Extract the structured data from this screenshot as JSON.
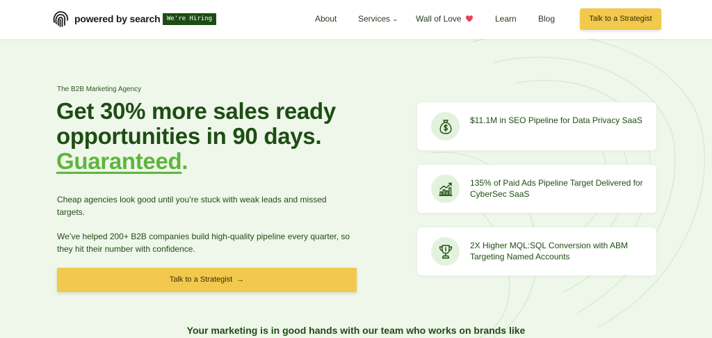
{
  "header": {
    "logo_text": "powered by search",
    "hiring_badge": "We're Hiring",
    "nav": [
      {
        "label": "About"
      },
      {
        "label": "Services"
      },
      {
        "label": "Wall of Love"
      },
      {
        "label": "Learn"
      },
      {
        "label": "Blog"
      }
    ],
    "cta_label": "Talk to a Strategist"
  },
  "hero": {
    "eyebrow": "The B2B Marketing Agency",
    "headline_part1": "Get 30% more sales ready opportunities in 90 days.",
    "headline_highlight": "Guaranteed",
    "headline_end": ".",
    "para1": "Cheap agencies look good until you’re stuck with weak leads and missed targets.",
    "para2": "We’ve helped 200+ B2B companies build high-quality pipeline every quarter, so they hit their number with confidence.",
    "cta_label": "Talk to a Strategist",
    "cta_arrow": "→"
  },
  "results": [
    {
      "icon": "money-bag-icon",
      "text": "$11.1M in SEO Pipeline for Data Privacy SaaS"
    },
    {
      "icon": "growth-chart-icon",
      "text": "135% of Paid Ads Pipeline Target Delivered for CyberSec SaaS"
    },
    {
      "icon": "trophy-icon",
      "text": "2X Higher MQL:SQL Conversion with ABM Targeting Named Accounts"
    }
  ],
  "brands_heading": "Your marketing is in good hands with our team who works on brands like",
  "colors": {
    "brand_green": "#1d4d13",
    "accent_green": "#5fb53c",
    "cta_yellow": "#f2c94c",
    "page_bg": "#eef7ea",
    "heart": "#e8415a"
  }
}
